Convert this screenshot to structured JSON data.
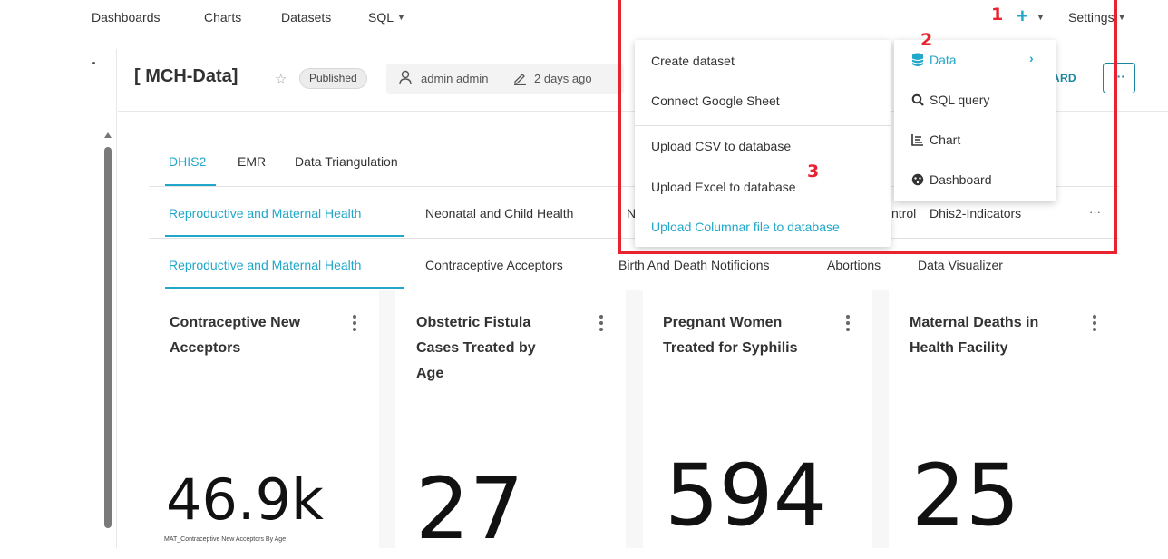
{
  "nav": {
    "items": [
      "Dashboards",
      "Charts",
      "Datasets",
      "SQL"
    ],
    "settings_label": "Settings"
  },
  "header": {
    "title": "[ MCH-Data]",
    "status": "Published",
    "owner": "admin admin",
    "modified": "2 days ago",
    "edit_label_partial": "ARD",
    "more_label": "···"
  },
  "tabs": {
    "level1": [
      "DHIS2",
      "EMR",
      "Data Triangulation"
    ],
    "level2": [
      "Reproductive and Maternal Health",
      "Neonatal and Child Health",
      "N",
      "ntrol",
      "Dhis2-Indicators"
    ],
    "level2_more": "···",
    "level3": [
      "Reproductive and Maternal Health",
      "Contraceptive Acceptors",
      "Birth And Death Notificions",
      "Abortions",
      "Data Visualizer"
    ]
  },
  "cards": [
    {
      "title_lines": [
        "Contraceptive New",
        "Acceptors"
      ],
      "value": "46.9k",
      "subcaption": "MAT_Contraceptive New Acceptors By Age"
    },
    {
      "title_lines": [
        "Obstetric Fistula",
        "Cases Treated by",
        "Age"
      ],
      "value": "27",
      "subcaption": ""
    },
    {
      "title_lines": [
        "Pregnant Women",
        "Treated for Syphilis"
      ],
      "value": "594",
      "subcaption": ""
    },
    {
      "title_lines": [
        "Maternal Deaths in",
        "Health Facility"
      ],
      "value": "25",
      "subcaption": ""
    }
  ],
  "dataset_menu": {
    "items": [
      "Create dataset",
      "Connect Google Sheet",
      "Upload CSV to database",
      "Upload Excel to database",
      "Upload Columnar file to database"
    ]
  },
  "new_menu": {
    "items": [
      {
        "label": "Data",
        "icon": "database-icon"
      },
      {
        "label": "SQL query",
        "icon": "search-icon"
      },
      {
        "label": "Chart",
        "icon": "chart-icon"
      },
      {
        "label": "Dashboard",
        "icon": "dashboard-icon"
      }
    ]
  },
  "annotations": {
    "step1": "1",
    "step2": "2",
    "step3": "3",
    "color": "#e8232f"
  },
  "colors": {
    "accent": "#20a7c9",
    "text": "#323232",
    "annotation": "#e8232f"
  }
}
